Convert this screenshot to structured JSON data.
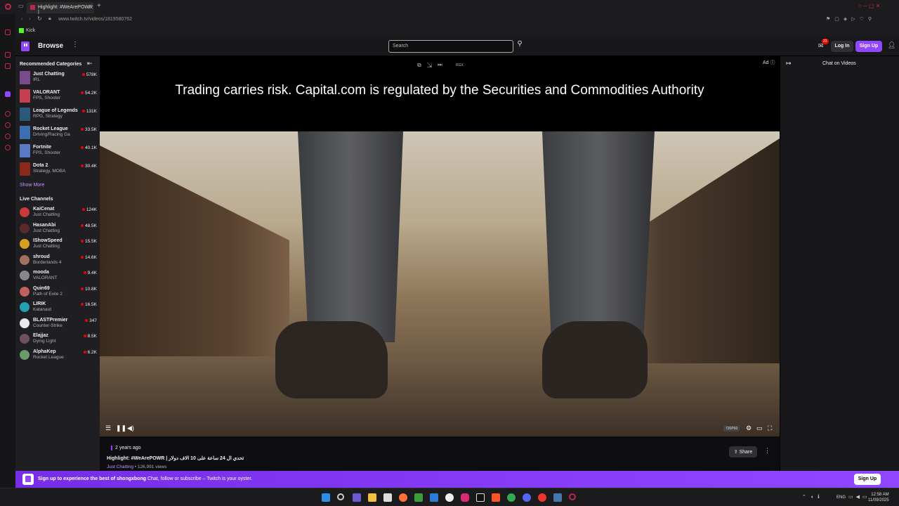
{
  "browser": {
    "tab_title": "Highlight: #WeArePOWR |",
    "url": "www.twitch.tv/videos/1819580762",
    "bookmark": "Kick"
  },
  "nav": {
    "browse": "Browse",
    "search_placeholder": "Search",
    "notif_count": "23",
    "login": "Log In",
    "signup": "Sign Up"
  },
  "sidebar": {
    "rec_header": "Recommended Categories",
    "categories": [
      {
        "name": "Just Chatting",
        "sub": "IRL",
        "viewers": "578K",
        "color": "#7a4b8a"
      },
      {
        "name": "VALORANT",
        "sub": "FPS, Shooter",
        "viewers": "54.2K",
        "color": "#c44050"
      },
      {
        "name": "League of Legends",
        "sub": "RPG, Strategy",
        "viewers": "131K",
        "color": "#2a5a7a"
      },
      {
        "name": "Rocket League",
        "sub": "Driving/Racing Ga",
        "viewers": "33.5K",
        "color": "#3b6fb0"
      },
      {
        "name": "Fortnite",
        "sub": "FPS, Shooter",
        "viewers": "40.1K",
        "color": "#5a7ac8"
      },
      {
        "name": "Dota 2",
        "sub": "Strategy, MOBA",
        "viewers": "30.4K",
        "color": "#8a2a1a"
      }
    ],
    "show_more": "Show More",
    "live_header": "Live Channels",
    "channels": [
      {
        "name": "KaiCenat",
        "sub": "Just Chatting",
        "viewers": "124K",
        "color": "#c83a3a"
      },
      {
        "name": "HasanAbi",
        "sub": "Just Chatting",
        "viewers": "48.5K",
        "color": "#5a2a2a"
      },
      {
        "name": "IShowSpeed",
        "sub": "Just Chatting",
        "viewers": "15.5K",
        "color": "#d8a020"
      },
      {
        "name": "shroud",
        "sub": "Borderlands 4",
        "viewers": "14.6K",
        "color": "#a07060"
      },
      {
        "name": "mooda",
        "sub": "VALORANT",
        "viewers": "9.4K",
        "color": "#888888"
      },
      {
        "name": "Quin69",
        "sub": "Path of Exile 2",
        "viewers": "10.8K",
        "color": "#c06060"
      },
      {
        "name": "LIRIK",
        "sub": "Katanaut",
        "viewers": "16.5K",
        "color": "#20a0b0"
      },
      {
        "name": "BLASTPremier",
        "sub": "Counter-Strike",
        "viewers": "347",
        "color": "#e8e8e8"
      },
      {
        "name": "Elajjaz",
        "sub": "Dying Light",
        "viewers": "8.5K",
        "color": "#705060"
      },
      {
        "name": "AlphaKep",
        "sub": "Rocket League",
        "viewers": "6.2K",
        "color": "#6a9a6a"
      }
    ]
  },
  "player": {
    "ad_text": "Trading carries risk. Capital.com is regulated by the Securities and Commodities Authority",
    "ad_label": "Ad",
    "quality": "720P60"
  },
  "video_info": {
    "ago": "2 years ago",
    "title": "Highlight: #WeArePOWR | تحدي ال 24 ساعة على 10 الاف دولار",
    "category": "Just Chatting",
    "views": " • 126,991 views",
    "share": "Share"
  },
  "chat": {
    "title": "Chat on Videos"
  },
  "banner": {
    "bold": "Sign up to experience the best of shongxbong",
    "rest": "  Chat, follow or subscribe – Twitch is your oyster.",
    "button": "Sign Up"
  },
  "taskbar": {
    "lang": "ENG",
    "time": "12:58 AM",
    "date": "11/09/2025"
  }
}
